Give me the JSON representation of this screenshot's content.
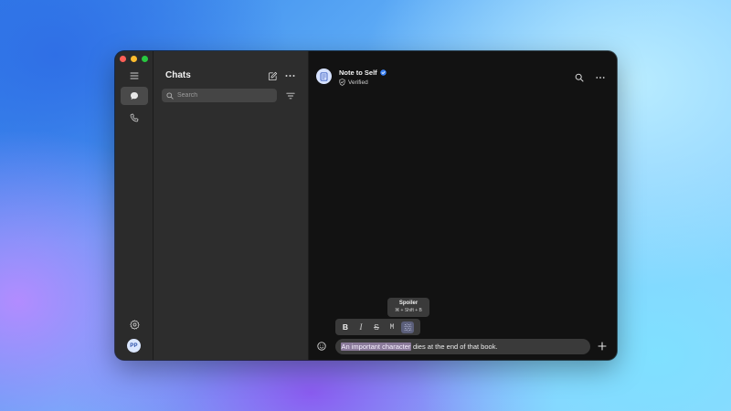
{
  "window": {
    "controls": {
      "close": "#ff5f57",
      "minimize": "#febc2e",
      "zoom": "#28c840"
    }
  },
  "rail": {
    "items": [
      {
        "name": "menu",
        "icon": "hamburger-icon"
      },
      {
        "name": "chats",
        "icon": "chat-bubble-icon",
        "active": true
      },
      {
        "name": "calls",
        "icon": "phone-icon"
      }
    ],
    "settings_icon": "gear-icon",
    "avatar_initials": "PP"
  },
  "chat_list": {
    "title": "Chats",
    "compose_icon": "compose-icon",
    "more_icon": "more-horizontal-icon",
    "search": {
      "placeholder": "Search",
      "value": ""
    },
    "filter_icon": "filter-icon"
  },
  "conversation": {
    "title": "Note to Self",
    "verified_badge_color": "#3b82f6",
    "subtitle": "Verified",
    "search_icon": "search-icon",
    "more_icon": "more-horizontal-icon"
  },
  "tooltip": {
    "title": "Spoiler",
    "shortcut": "⌘ + Shift + B"
  },
  "format_bar": {
    "buttons": [
      {
        "label": "B",
        "name": "bold"
      },
      {
        "label": "I",
        "name": "italic"
      },
      {
        "label": "S",
        "name": "strikethrough"
      },
      {
        "label": "M",
        "name": "monospace"
      },
      {
        "label": "",
        "name": "spoiler",
        "icon": "spoiler-icon",
        "active": true
      }
    ]
  },
  "composer": {
    "selected_text": "An important character",
    "rest_text": " dies at the end of that book.",
    "emoji_icon": "emoji-icon",
    "plus_icon": "plus-icon"
  },
  "colors": {
    "accent": "#3b82f6",
    "selection": "#8a7a9a",
    "spoiler_active": "#5b5f7a"
  }
}
